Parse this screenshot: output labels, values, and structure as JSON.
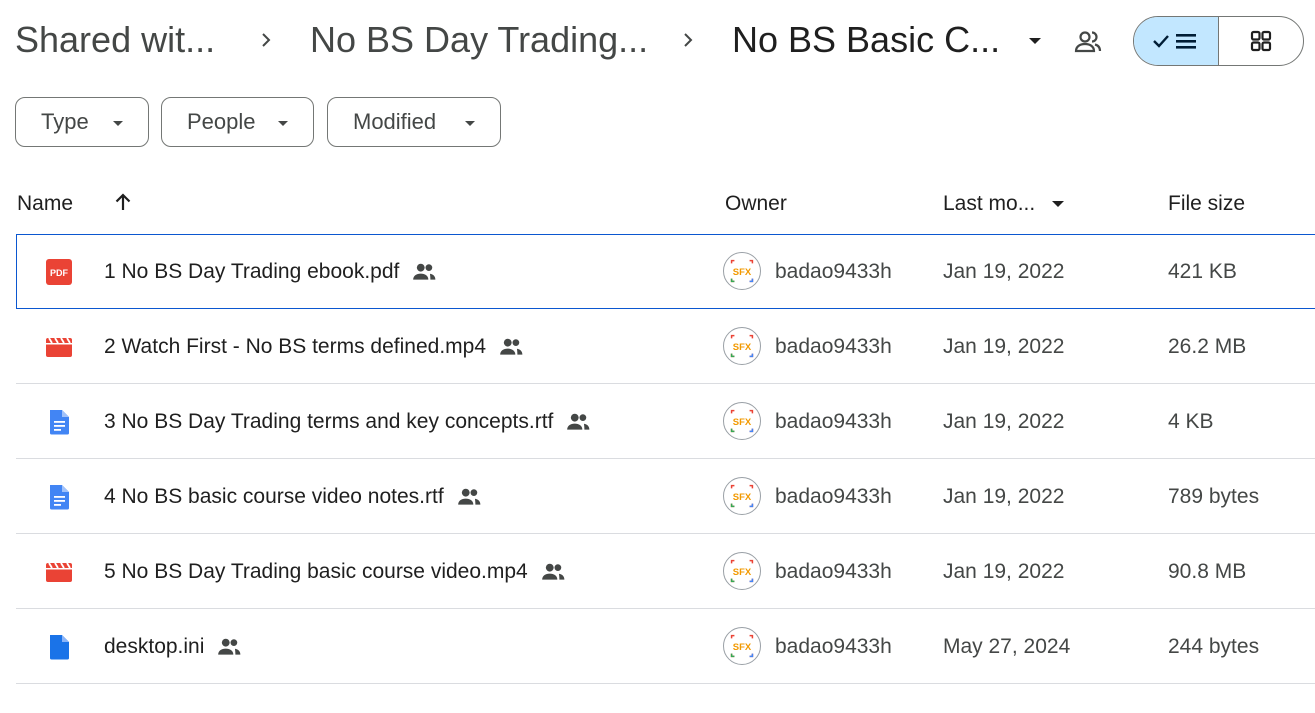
{
  "breadcrumb": {
    "items": [
      "Shared wit...",
      "No BS Day Trading...",
      "No BS Basic C..."
    ]
  },
  "filters": [
    "Type",
    "People",
    "Modified"
  ],
  "columns": {
    "name": "Name",
    "owner": "Owner",
    "last_modified": "Last mo...",
    "file_size": "File size"
  },
  "files": [
    {
      "name": "1 No BS Day Trading ebook.pdf",
      "type": "pdf",
      "owner": "badao9433h",
      "modified": "Jan 19, 2022",
      "size": "421 KB"
    },
    {
      "name": "2 Watch First - No BS terms defined.mp4",
      "type": "video",
      "owner": "badao9433h",
      "modified": "Jan 19, 2022",
      "size": "26.2 MB"
    },
    {
      "name": "3 No BS Day Trading terms and key concepts.rtf",
      "type": "doc",
      "owner": "badao9433h",
      "modified": "Jan 19, 2022",
      "size": "4 KB"
    },
    {
      "name": "4 No BS basic course video notes.rtf",
      "type": "doc",
      "owner": "badao9433h",
      "modified": "Jan 19, 2022",
      "size": "789 bytes"
    },
    {
      "name": "5 No BS Day Trading basic course video.mp4",
      "type": "video",
      "owner": "badao9433h",
      "modified": "Jan 19, 2022",
      "size": "90.8 MB"
    },
    {
      "name": "desktop.ini",
      "type": "file",
      "owner": "badao9433h",
      "modified": "May 27, 2024",
      "size": "244 bytes"
    }
  ],
  "icons": {
    "pdf_label": "PDF",
    "avatar_label": "SFX"
  },
  "colors": {
    "pdf": "#ea4335",
    "video": "#ea4335",
    "doc": "#4285f4",
    "file": "#1a73e8",
    "selected_border": "#0b57d0",
    "toggle_active": "#c2e7ff"
  }
}
